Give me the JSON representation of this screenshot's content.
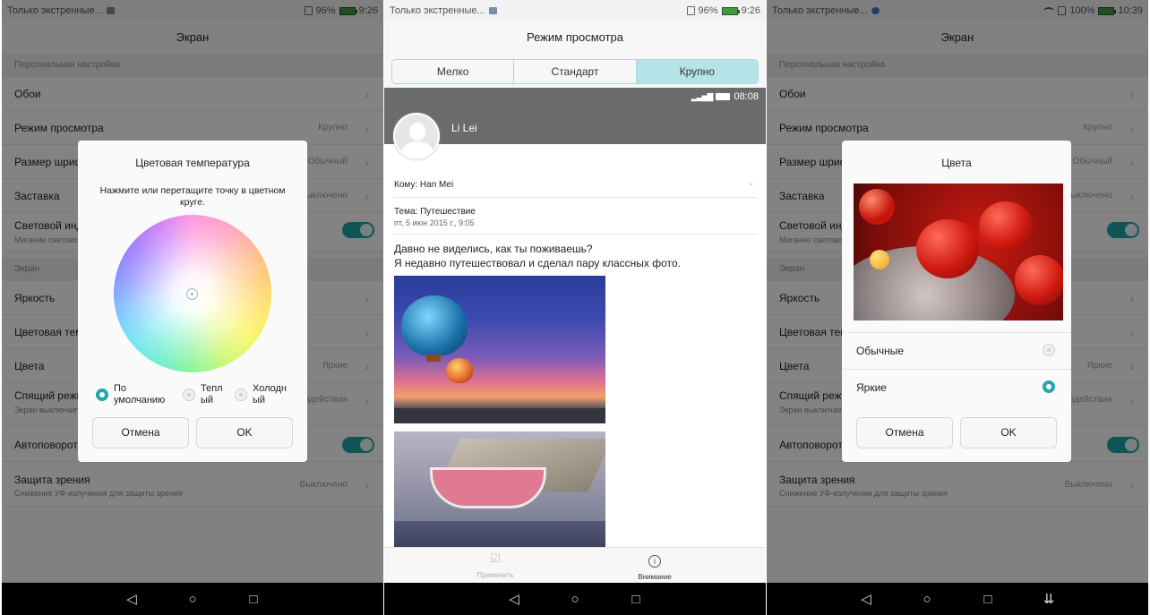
{
  "statusbar": {
    "left": {
      "text": "Только экстренные..."
    },
    "right": {
      "battery": "96%",
      "time": "9:26"
    },
    "right3": {
      "battery": "100%",
      "time": "10:39"
    }
  },
  "screen1": {
    "title": "Экран",
    "section1": "Персональная настройка",
    "rows": [
      {
        "label": "Обои",
        "value": ""
      },
      {
        "label": "Режим просмотра",
        "value": "Крупно"
      },
      {
        "label": "Размер шрифта",
        "value": "Обычный"
      },
      {
        "label": "Заставка",
        "value": "Выключено"
      },
      {
        "label": "Световой индикатор",
        "sub": "Мигание светового индикатора"
      }
    ],
    "section2": "Экран",
    "rows2": [
      {
        "label": "Яркость",
        "value": ""
      },
      {
        "label": "Цветовая температура",
        "value": ""
      },
      {
        "label": "Цвета",
        "value": "Яркие"
      },
      {
        "label": "Спящий режим",
        "sub": "Экран выключается после бездействия",
        "value": "бездействия"
      },
      {
        "label": "Автоповорот экрана"
      },
      {
        "label": "Защита зрения",
        "sub": "Снижение УФ-излучения для защиты зрения",
        "value": "Выключено"
      }
    ]
  },
  "dialog_temp": {
    "title": "Цветовая температура",
    "hint": "Нажмите или перетащите точку в цветном круге.",
    "options": [
      {
        "label": "По умолчанию",
        "selected": true
      },
      {
        "label": "Теплый",
        "selected": false
      },
      {
        "label": "Холодный",
        "selected": false
      }
    ],
    "cancel": "Отмена",
    "ok": "OK"
  },
  "screen2": {
    "title": "Режим просмотра",
    "tabs": [
      "Мелко",
      "Стандарт",
      "Крупно"
    ],
    "active_tab": "Крупно",
    "preview": {
      "time": "08:08",
      "sender": "Li Lei",
      "to": "Кому: Han Mei",
      "subject": "Тема: Путешествие",
      "date": "пт, 5 июн 2015 г., 9:05",
      "body_line1": "Давно не виделись, как ты поживаешь?",
      "body_line2": "Я недавно путешествовал и сделал пару классных фото."
    },
    "actions": {
      "apply": "Применить",
      "attention": "Внимание"
    }
  },
  "dialog_colors": {
    "title": "Цвета",
    "options": [
      {
        "label": "Обычные",
        "selected": false
      },
      {
        "label": "Яркие",
        "selected": true
      }
    ],
    "cancel": "Отмена",
    "ok": "OK"
  },
  "colors": {
    "accent": "#1fa3a3",
    "navbar": "#000000"
  }
}
